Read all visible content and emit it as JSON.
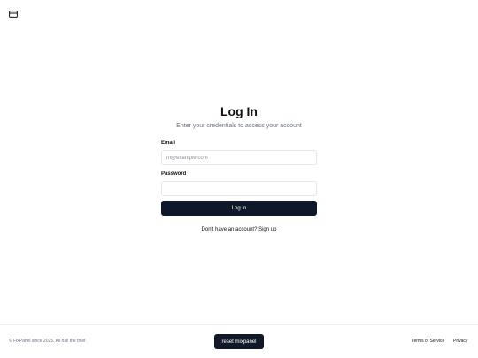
{
  "header": {
    "logo_icon": "card-icon"
  },
  "login": {
    "title": "Log In",
    "subtitle": "Enter your credentials to access your account",
    "email_label": "Email",
    "email_placeholder": "m@example.com",
    "email_value": "",
    "password_label": "Password",
    "password_value": "",
    "submit_label": "Log In",
    "signup_prompt": "Don't have an account?",
    "signup_link": "Sign up"
  },
  "footer": {
    "copyright": "© FixPanel since 2025. All hail the thief.",
    "reset_label": "reset mixpanel",
    "terms_label": "Terms of Service",
    "privacy_label": "Privacy"
  },
  "colors": {
    "primary_button": "#0f172a",
    "muted_text": "#6b7280",
    "border": "#e5e7eb"
  }
}
